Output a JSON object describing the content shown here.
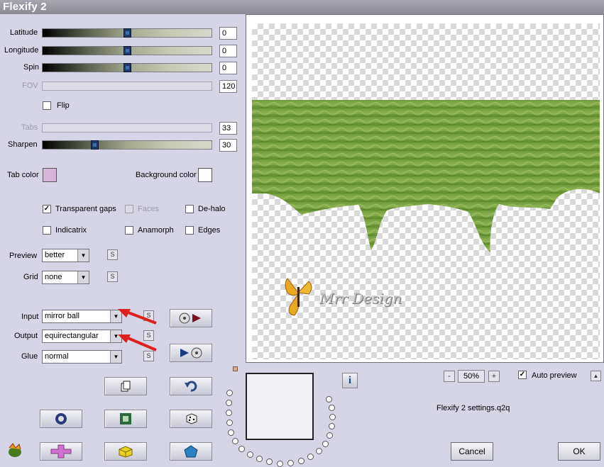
{
  "window": {
    "title": "Flexify 2"
  },
  "sliders": {
    "latitude": {
      "label": "Latitude",
      "value": "0"
    },
    "longitude": {
      "label": "Longitude",
      "value": "0"
    },
    "spin": {
      "label": "Spin",
      "value": "0"
    },
    "fov": {
      "label": "FOV",
      "value": "120"
    },
    "tabs": {
      "label": "Tabs",
      "value": "33"
    },
    "sharpen": {
      "label": "Sharpen",
      "value": "30"
    }
  },
  "flip": {
    "label": "Flip",
    "checked": false
  },
  "colors": {
    "tab_label": "Tab color",
    "tab_color": "#d8b4d8",
    "background_label": "Background color",
    "background_color": "#ffffff"
  },
  "options": {
    "transparent_gaps": {
      "label": "Transparent gaps",
      "checked": true
    },
    "faces": {
      "label": "Faces",
      "checked": false
    },
    "de_halo": {
      "label": "De-halo",
      "checked": false
    },
    "indicatrix": {
      "label": "Indicatrix",
      "checked": false
    },
    "anamorph": {
      "label": "Anamorph",
      "checked": false
    },
    "edges": {
      "label": "Edges",
      "checked": false
    }
  },
  "combos": {
    "preview": {
      "label": "Preview",
      "value": "better"
    },
    "grid": {
      "label": "Grid",
      "value": "none"
    },
    "input": {
      "label": "Input",
      "value": "mirror ball"
    },
    "output": {
      "label": "Output",
      "value": "equirectangular"
    },
    "glue": {
      "label": "Glue",
      "value": "normal"
    }
  },
  "small_button": "S",
  "zoom": {
    "minus": "-",
    "value": "50%",
    "plus": "+"
  },
  "auto_preview": {
    "label": "Auto preview",
    "checked": true
  },
  "settings_file": "Flexify 2 settings.q2q",
  "buttons": {
    "cancel": "Cancel",
    "ok": "OK"
  },
  "info_label": "i",
  "watermark": "Mrr Design",
  "collapse_label": "▲"
}
